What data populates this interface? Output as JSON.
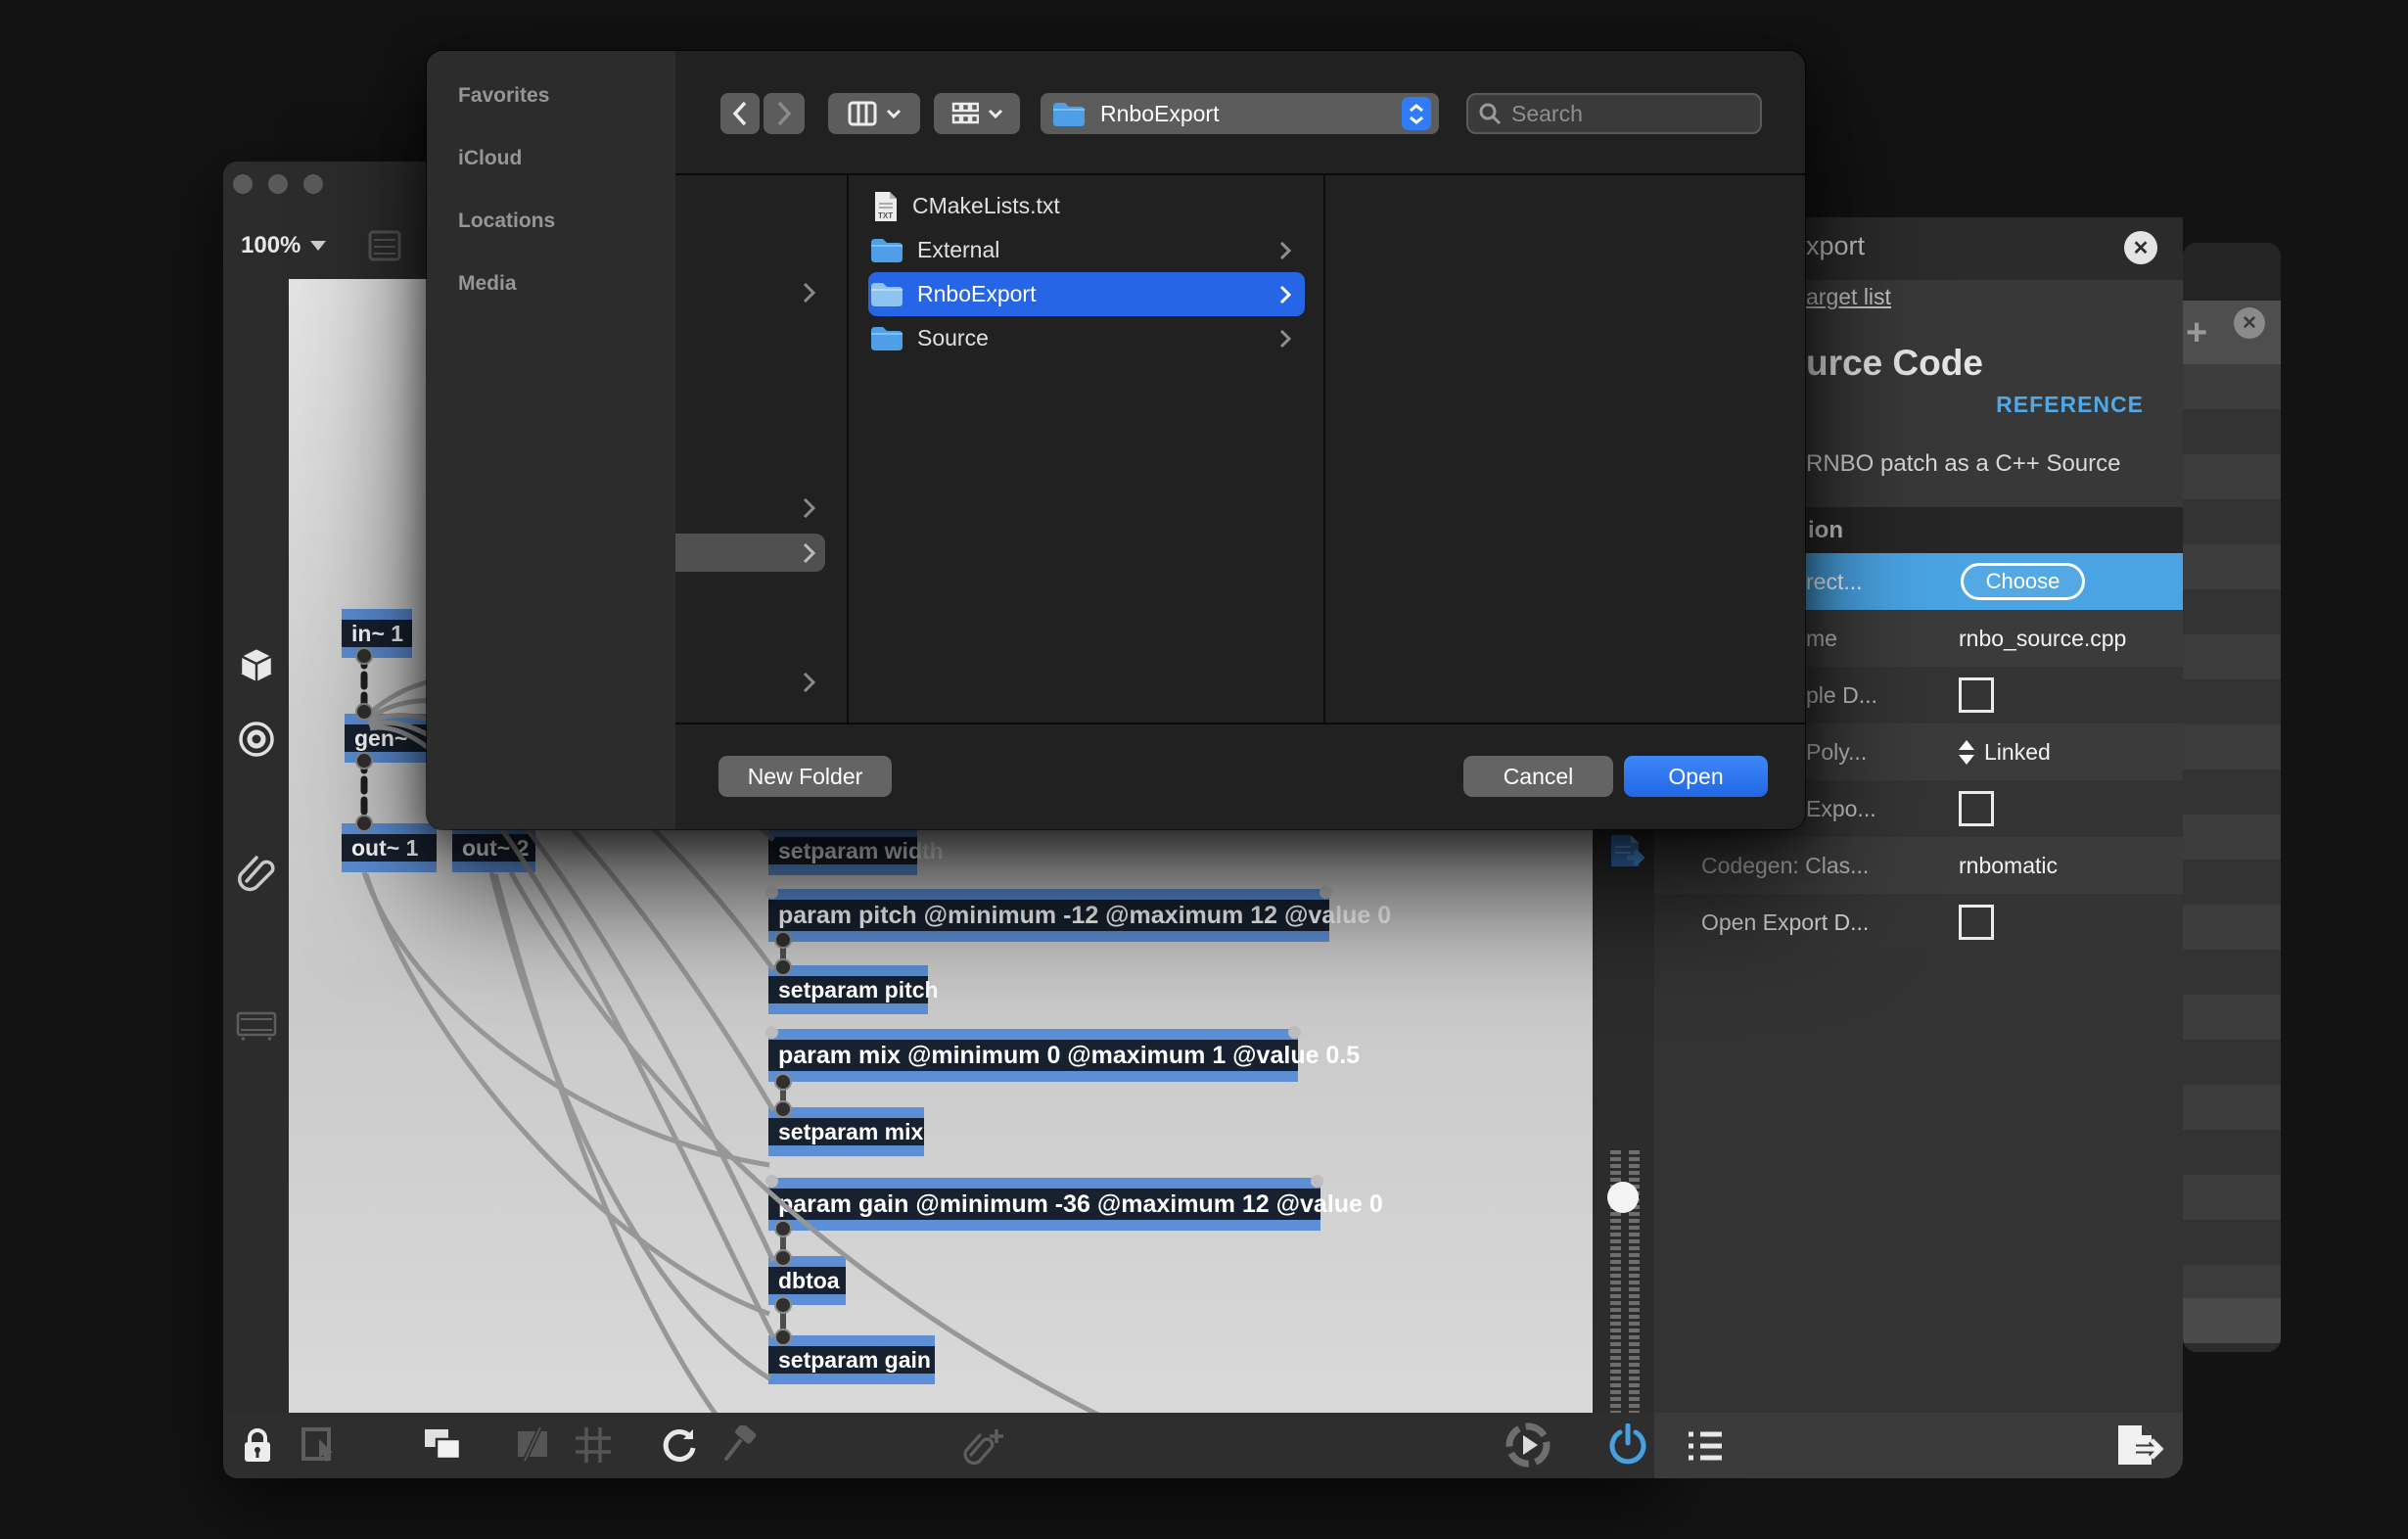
{
  "window": {
    "zoom_label": "100%"
  },
  "dialog": {
    "sidebar_sections": [
      {
        "label": "Favorites"
      },
      {
        "label": "iCloud"
      },
      {
        "label": "Locations"
      },
      {
        "label": "Media"
      }
    ],
    "toolbar": {
      "folder_label": "RnboExport",
      "search_placeholder": "Search"
    },
    "files": [
      {
        "name": "CMakeLists.txt",
        "type": "text-file"
      },
      {
        "name": "External",
        "type": "folder"
      },
      {
        "name": "RnboExport",
        "type": "folder",
        "selected": true
      },
      {
        "name": "Source",
        "type": "folder"
      }
    ],
    "buttons": {
      "new_folder": "New Folder",
      "cancel": "Cancel",
      "open": "Open"
    }
  },
  "patcher": {
    "objects": [
      {
        "label": "in~ 1"
      },
      {
        "label": "gen~"
      },
      {
        "label": "out~ 1"
      },
      {
        "label": "out~ 2"
      },
      {
        "label": "setparam width"
      },
      {
        "label": "param pitch @minimum -12 @maximum 12 @value 0"
      },
      {
        "label": "setparam pitch"
      },
      {
        "label": "param mix @minimum 0 @maximum 1 @value 0.5"
      },
      {
        "label": "setparam mix"
      },
      {
        "label": "param gain @minimum -36 @maximum 12 @value 0"
      },
      {
        "label": "dbtoa"
      },
      {
        "label": "setparam gain"
      }
    ]
  },
  "export_panel": {
    "title": "xport",
    "target_link": "arget list",
    "heading": "urce Code",
    "reference": "REFERENCE",
    "description": "RNBO patch as a C++ Source",
    "section": "ion",
    "rows": [
      {
        "label": "rect...",
        "button": "Choose"
      },
      {
        "label": "me",
        "value": "rnbo_source.cpp"
      },
      {
        "label": "ple D..."
      },
      {
        "label": "Poly...",
        "value": "Linked"
      },
      {
        "label": "Expo..."
      },
      {
        "label": "Codegen: Clas...",
        "value": "rnbomatic"
      },
      {
        "label": "Open Export D..."
      }
    ]
  },
  "colors": {
    "accent_blue": "#2f7cf6",
    "file_selection_blue": "#2565e6",
    "panel_highlight_blue": "#4aa4e4",
    "reference_link_blue": "#4fa8e8",
    "folder_icon_blue": "#4f9fe8",
    "object_body": "#17212f",
    "object_ports": "#5c8fd6",
    "power_blue": "#47a0e0"
  }
}
